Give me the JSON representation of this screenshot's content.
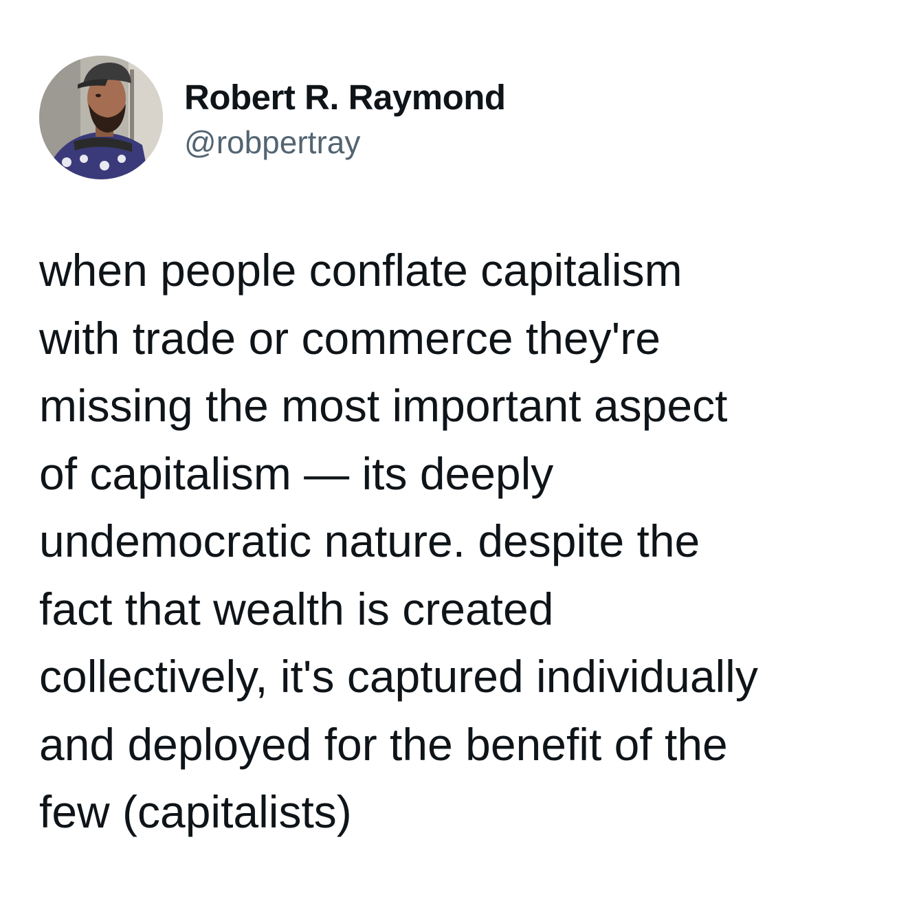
{
  "author": {
    "display_name": "Robert R. Raymond",
    "handle": "@robpertray"
  },
  "tweet": {
    "lines": [
      "when people conflate capitalism",
      "with trade or commerce they're",
      "missing the most important aspect",
      "of capitalism — its deeply",
      "undemocratic nature. despite the",
      "fact that wealth is created",
      "collectively, it's captured individually",
      "and deployed for the benefit of the",
      "few (capitalists)"
    ]
  },
  "colors": {
    "text_primary": "#0f1419",
    "text_secondary": "#536471",
    "background": "#ffffff"
  }
}
